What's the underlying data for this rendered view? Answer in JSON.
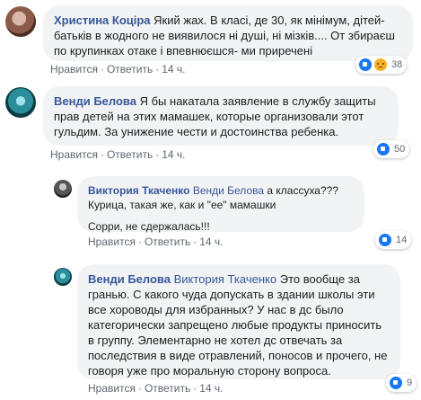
{
  "labels": {
    "like": "Нравится",
    "reply": "Ответить",
    "dot": "·"
  },
  "comments": [
    {
      "author": "Христина Коціра",
      "text": "Який жах. В класі, де 30, як мінімум, дітей-батьків в жодного не виявилося ні душі, ні мізків.... От збираєш по крупинках отаке і впевнюєшся- ми приречені",
      "time": "14 ч.",
      "reaction_count": "38",
      "reaction_icons": [
        "like-icon",
        "sad-icon"
      ]
    },
    {
      "author": "Венди Белова",
      "text": "Я бы накатала заявление в службу защиты прав детей на этих мамашек, которые организовали этот гульдим. За унижение чести и достоинства ребенка.",
      "time": "14 ч.",
      "reaction_count": "50",
      "reaction_icons": [
        "like-icon"
      ]
    },
    {
      "author": "Виктория Ткаченко",
      "mention": "Венди Белова",
      "text": "а классуха???",
      "text2": "Курица, такая же, как и \"ее\" мамашки",
      "text3": "Сорри, не сдержалась!!!",
      "time": "14 ч.",
      "reaction_count": "14",
      "reaction_icons": [
        "like-icon"
      ]
    },
    {
      "author": "Венди Белова",
      "mention": "Виктория Ткаченко",
      "text": "Это вообще за гранью. С какого чуда допускать в здании школы эти все хороводы для избранных? У нас в дс было категорически запрещено любые продукты приносить в группу. Элементарно не хотел дс отвечать за последствия в виде отравлений, поносов и прочего, не говоря уже про моральную сторону вопроса.",
      "time": "14 ч.",
      "reaction_count": "9",
      "reaction_icons": [
        "like-icon"
      ]
    }
  ]
}
